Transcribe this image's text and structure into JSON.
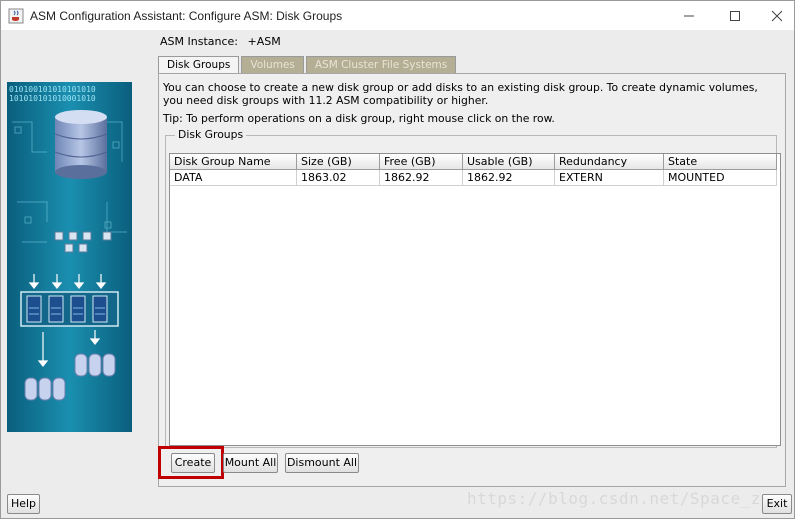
{
  "window": {
    "title": "ASM Configuration Assistant: Configure ASM: Disk Groups",
    "controls": [
      "minimize",
      "maximize",
      "close"
    ]
  },
  "instance": {
    "label": "ASM Instance:",
    "value": "+ASM"
  },
  "tabs": [
    {
      "label": "Disk Groups",
      "active": true
    },
    {
      "label": "Volumes",
      "active": false
    },
    {
      "label": "ASM Cluster File Systems",
      "active": false
    }
  ],
  "description": "You can choose to create a new disk group or add disks to an existing disk group. To create dynamic volumes, you need disk groups with 11.2 ASM compatibility or higher.",
  "tip": "Tip: To perform operations on a disk group, right mouse click on the row.",
  "disk_groups": {
    "label": "Disk Groups",
    "columns": [
      "Disk Group Name",
      "Size (GB)",
      "Free (GB)",
      "Usable (GB)",
      "Redundancy",
      "State"
    ],
    "rows": [
      [
        "DATA",
        "1863.02",
        "1862.92",
        "1862.92",
        "EXTERN",
        "MOUNTED"
      ]
    ]
  },
  "buttons": {
    "create": "Create",
    "mount_all": "Mount All",
    "dismount_all": "Dismount All",
    "help": "Help",
    "exit": "Exit"
  },
  "side_art": {
    "binary_line_1": "010100101010101010",
    "binary_line_2": "101010101010001010"
  },
  "watermark": "https://blog.csdn.net/Space_ze"
}
